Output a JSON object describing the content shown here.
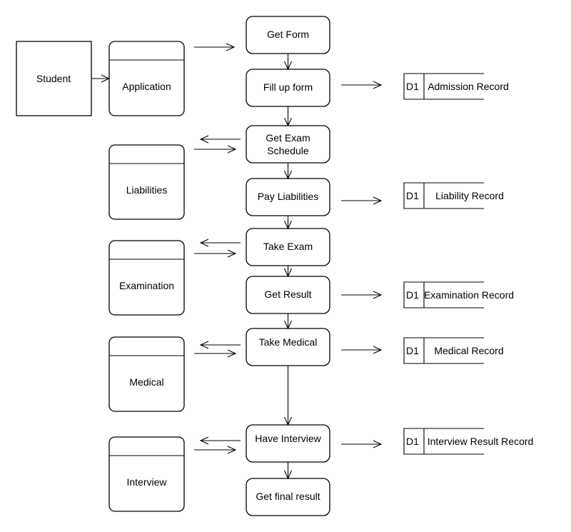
{
  "external_entity": {
    "label": "Student"
  },
  "left_stores": [
    {
      "label": "Application"
    },
    {
      "label": "Liabilities"
    },
    {
      "label": "Examination"
    },
    {
      "label": "Medical"
    },
    {
      "label": "Interview"
    }
  ],
  "processes": [
    {
      "label": "Get Form"
    },
    {
      "label": "Fill up form"
    },
    {
      "label_line1": "Get Exam",
      "label_line2": "Schedule"
    },
    {
      "label": "Pay Liabilities"
    },
    {
      "label": "Take Exam"
    },
    {
      "label": "Get Result"
    },
    {
      "label": "Take Medical"
    },
    {
      "label": "Have Interview"
    },
    {
      "label": "Get final result"
    }
  ],
  "data_stores": [
    {
      "id": "D1",
      "label": "Admission Record"
    },
    {
      "id": "D1",
      "label": "Liability Record"
    },
    {
      "id": "D1",
      "label": "Examination Record"
    },
    {
      "id": "D1",
      "label": "Medical Record"
    },
    {
      "id": "D1",
      "label": "Interview Result Record"
    }
  ]
}
